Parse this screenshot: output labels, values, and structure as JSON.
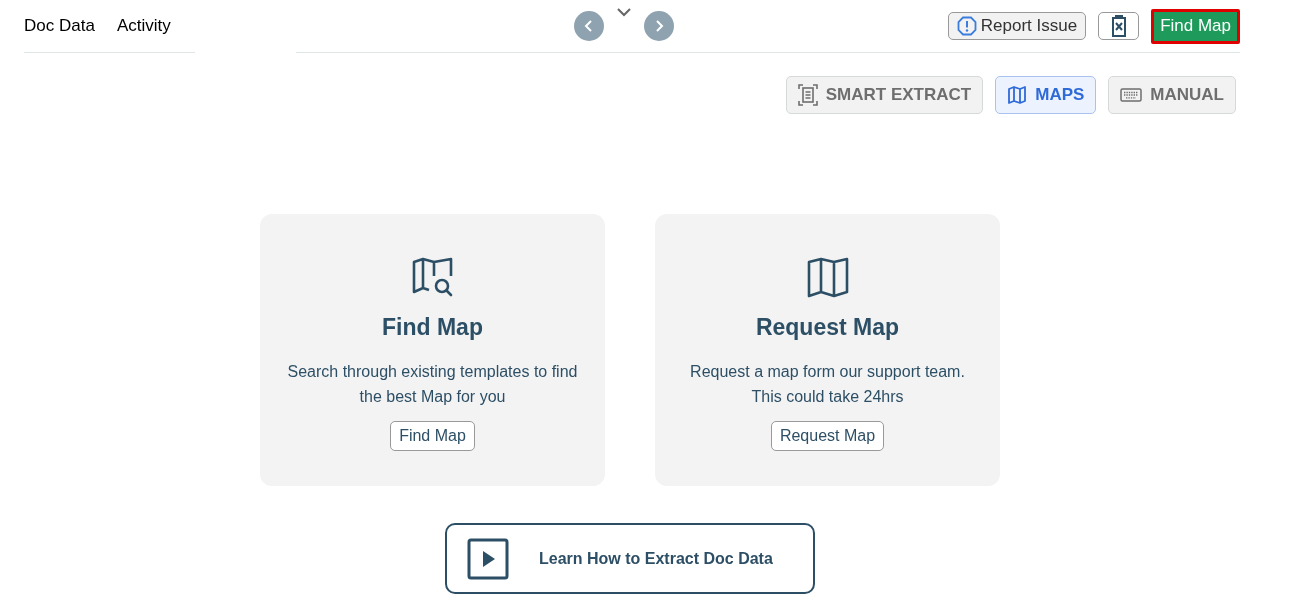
{
  "tabs": [
    {
      "label": "Doc Data"
    },
    {
      "label": "Activity"
    }
  ],
  "top_actions": {
    "report": "Report Issue",
    "primary": "Find Map",
    "primary_highlighted": true
  },
  "modes": [
    {
      "kind": "smart",
      "label": "SMART EXTRACT",
      "selected": false
    },
    {
      "kind": "maps",
      "label": "MAPS",
      "selected": true
    },
    {
      "kind": "manual",
      "label": "MANUAL",
      "selected": false
    }
  ],
  "cards": [
    {
      "kind": "find",
      "title": "Find Map",
      "description": "Search through existing templates to find the best Map for you",
      "button": "Find Map"
    },
    {
      "kind": "request",
      "title": "Request Map",
      "description": "Request a map form our support team. This could take 24hrs",
      "button": "Request Map"
    }
  ],
  "video_button": "Learn How to Extract Doc Data"
}
